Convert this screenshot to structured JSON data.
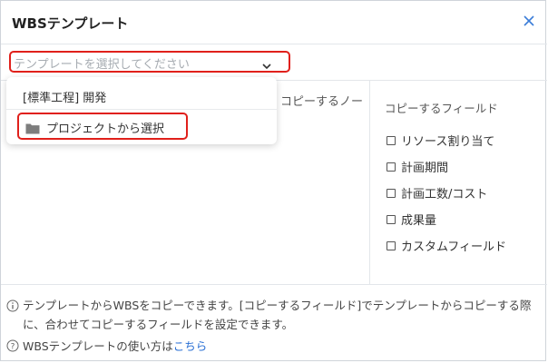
{
  "dialog": {
    "title": "WBSテンプレート",
    "close_icon": "close-icon"
  },
  "toolbar": {
    "template_select_placeholder": "テンプレートを選択してください",
    "chevron_icon": "chevron-down-icon"
  },
  "dropdown": {
    "items": [
      {
        "label": "[標準工程] 開発"
      },
      {
        "label": "プロジェクトから選択",
        "icon": "folder-icon"
      }
    ]
  },
  "content": {
    "left_partial_text": "コピーするノー",
    "copy_fields_title": "コピーするフィールド",
    "fields": [
      {
        "label": "リソース割り当て",
        "checked": false
      },
      {
        "label": "計画期間",
        "checked": false
      },
      {
        "label": "計画工数/コスト",
        "checked": false
      },
      {
        "label": "成果量",
        "checked": false
      },
      {
        "label": "カスタムフィールド",
        "checked": false
      }
    ]
  },
  "footer": {
    "info_text": "テンプレートからWBSをコピーできます。[コピーするフィールド]でテンプレートからコピーする際に、合わせてコピーするフィールドを設定できます。",
    "help_text": "WBSテンプレートの使い方は",
    "help_link": "こちら"
  },
  "colors": {
    "highlight": "#e0201b",
    "link": "#2a6fd4",
    "close_icon": "#3b7dd8"
  }
}
